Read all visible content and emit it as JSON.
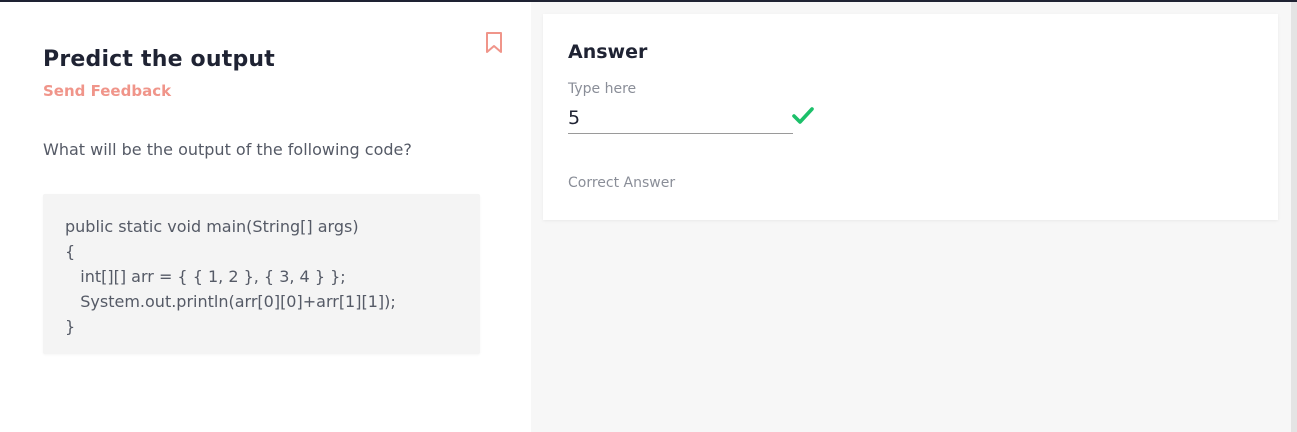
{
  "question": {
    "title": "Predict the output",
    "feedback_label": "Send Feedback",
    "prompt": "What will be the output of the following code?",
    "code_lines": [
      "public static void main(String[] args)",
      "{",
      "   int[][] arr = { { 1, 2 }, { 3, 4 } };",
      "   System.out.println(arr[0][0]+arr[1][1]);",
      "}"
    ],
    "bookmark_icon": "bookmark-icon"
  },
  "answer": {
    "heading": "Answer",
    "input_label": "Type here",
    "input_value": "5",
    "status_icon": "check-icon",
    "status_color": "#1cc06a",
    "correct_label": "Correct Answer"
  },
  "colors": {
    "accent": "#f0958a",
    "title": "#1f2333"
  }
}
